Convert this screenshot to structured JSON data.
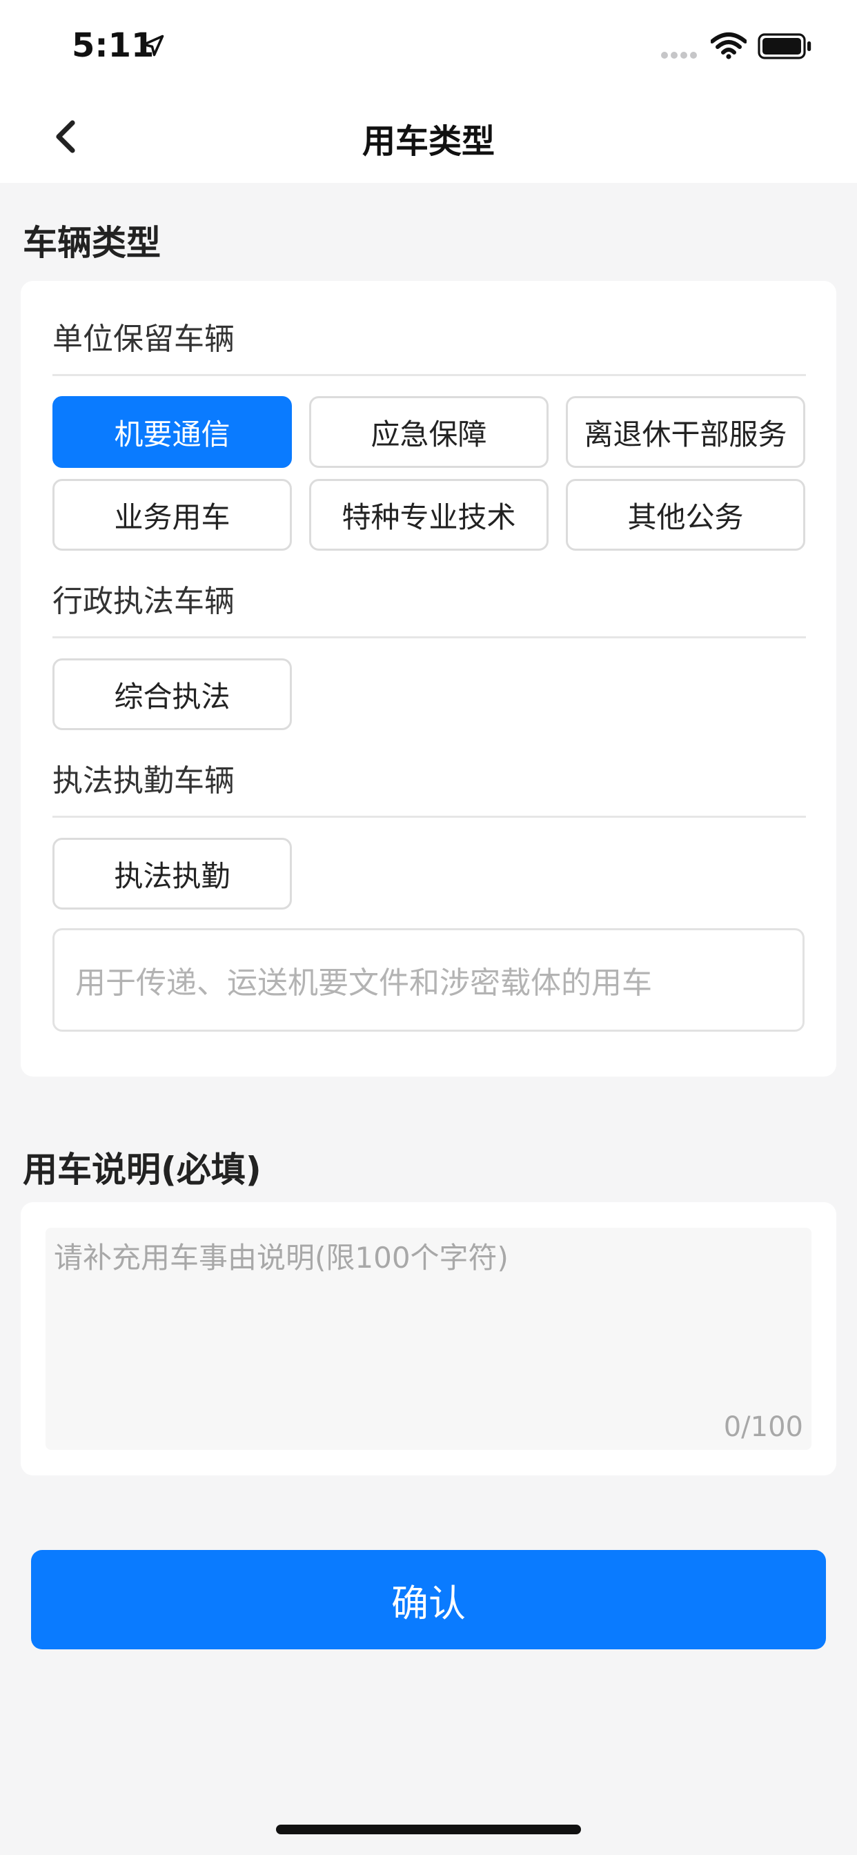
{
  "status_bar": {
    "time": "5:11"
  },
  "nav": {
    "title": "用车类型"
  },
  "vehicle_type": {
    "section_title": "车辆类型",
    "groups": [
      {
        "label": "单位保留车辆",
        "options": [
          "机要通信",
          "应急保障",
          "离退休干部服务",
          "业务用车",
          "特种专业技术",
          "其他公务"
        ]
      },
      {
        "label": "行政执法车辆",
        "options": [
          "综合执法"
        ]
      },
      {
        "label": "执法执勤车辆",
        "options": [
          "执法执勤"
        ]
      }
    ],
    "selected": "机要通信",
    "description": "用于传递、运送机要文件和涉密载体的用车"
  },
  "remark": {
    "section_title": "用车说明(必填)",
    "placeholder": "请补充用车事由说明(限100个字符)",
    "counter": "0/100"
  },
  "confirm_label": "确认",
  "colors": {
    "accent": "#0a7bff",
    "background": "#f5f5f6"
  }
}
